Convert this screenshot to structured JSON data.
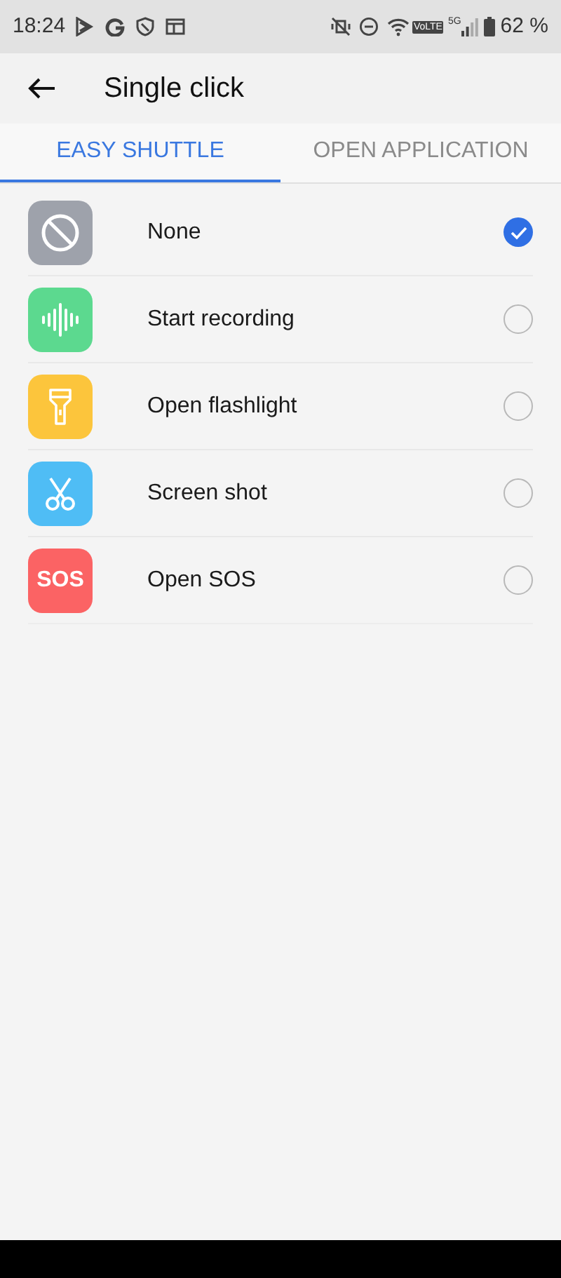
{
  "status_bar": {
    "time": "18:24",
    "volte": "VoLTE",
    "network": "5G",
    "battery": "62 %"
  },
  "header": {
    "title": "Single click"
  },
  "tabs": [
    {
      "label": "EASY SHUTTLE",
      "selected": true
    },
    {
      "label": "OPEN APPLICATION",
      "selected": false
    }
  ],
  "options": [
    {
      "kind": "none",
      "color": "#9ea2ab",
      "label": "None",
      "selected": true
    },
    {
      "kind": "recording",
      "color": "#5cd98f",
      "label": "Start recording",
      "selected": false
    },
    {
      "kind": "flashlight",
      "color": "#fcc53c",
      "label": "Open flashlight",
      "selected": false
    },
    {
      "kind": "scissors",
      "color": "#4fbdf5",
      "label": "Screen shot",
      "selected": false
    },
    {
      "kind": "sos",
      "color": "#fb6364",
      "label": "Open SOS",
      "icon_text": "SOS",
      "selected": false
    }
  ]
}
